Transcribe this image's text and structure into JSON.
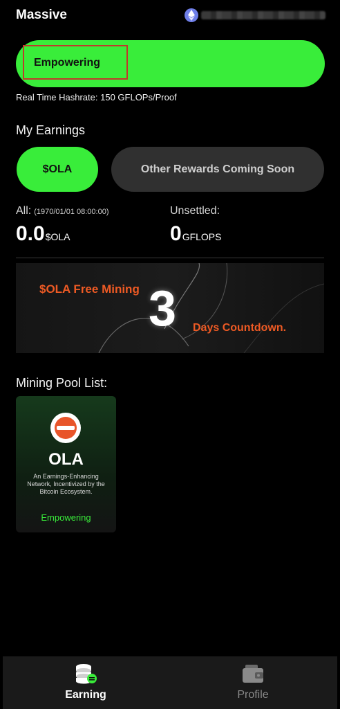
{
  "header": {
    "app_title": "Massive",
    "wallet_icon": "ethereum-icon"
  },
  "status": {
    "label": "Empowering",
    "accent_color": "#39ed3a"
  },
  "hashrate": {
    "text": "Real Time Hashrate:  150 GFLOPs/Proof"
  },
  "earnings": {
    "title": "My Earnings",
    "tabs": {
      "token": "$OLA",
      "other": "Other Rewards Coming Soon"
    },
    "all": {
      "label": "All:",
      "timestamp": "(1970/01/01 08:00:00)",
      "value": "0.0",
      "unit": "$OLA"
    },
    "unsettled": {
      "label": "Unsettled:",
      "value": "0",
      "unit": "GFLOPS"
    }
  },
  "banner": {
    "text1": "$OLA Free Mining",
    "number": "3",
    "text2": "Days Countdown.",
    "accent_color": "#ee5a24"
  },
  "pools": {
    "title": "Mining Pool List:",
    "items": [
      {
        "name": "OLA",
        "description": "An Earnings-Enhancing Network, Incentivized by the Bitcoin Ecosystem.",
        "status": "Empowering",
        "logo_icon": "ola-logo-icon"
      }
    ]
  },
  "nav": {
    "items": [
      {
        "label": "Earning",
        "icon": "database-coin-icon",
        "active": true
      },
      {
        "label": "Profile",
        "icon": "wallet-icon",
        "active": false
      }
    ]
  }
}
